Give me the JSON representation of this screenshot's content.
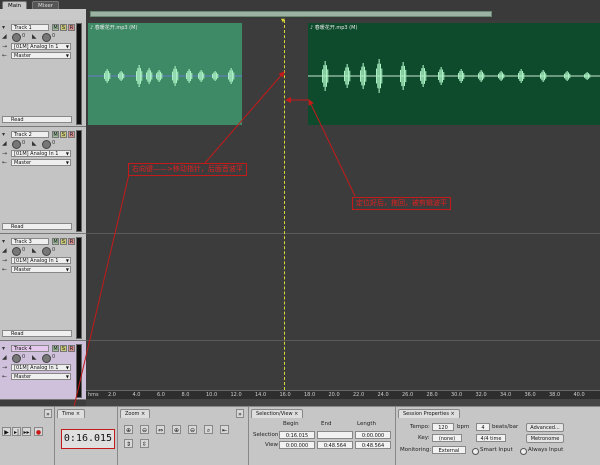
{
  "top_tabs": [
    "Main",
    "Mixer"
  ],
  "tracks": [
    {
      "name": "Track 1",
      "input": "[01M] Analog In 1",
      "output": "Master",
      "automation": "Read",
      "volume": "0",
      "pan": "0",
      "selected": false
    },
    {
      "name": "Track 2",
      "input": "[01M] Analog In 1",
      "output": "Master",
      "automation": "Read",
      "volume": "0",
      "pan": "0",
      "selected": false
    },
    {
      "name": "Track 3",
      "input": "[01M] Analog In 1",
      "output": "Master",
      "automation": "Read",
      "volume": "0",
      "pan": "0",
      "selected": false
    },
    {
      "name": "Track 4",
      "input": "[01M] Analog In 1",
      "output": "Master",
      "automation": "Read",
      "volume": "0",
      "pan": "0",
      "selected": true
    }
  ],
  "track_buttons": {
    "mute": "M",
    "solo": "S",
    "record": "R"
  },
  "clips": [
    {
      "label": "♪ 春暖花开.mp3 (M)"
    },
    {
      "label": "♪ 春暖花开.mp3 (M)"
    }
  ],
  "ruler": {
    "unit": "hms",
    "ticks": [
      "2.0",
      "4.0",
      "6.0",
      "8.0",
      "10.0",
      "12.0",
      "14.0",
      "16.0",
      "18.0",
      "20.0",
      "22.0",
      "24.0",
      "26.0",
      "28.0",
      "30.0",
      "32.0",
      "34.0",
      "36.0",
      "38.0",
      "40.0"
    ]
  },
  "annotations": {
    "left_note": "右向键——>移动指针，后面音波平",
    "right_note": "定位好后，拖回，被剪辑波平"
  },
  "time_panel": {
    "tab": "Time",
    "value": "0:16.015"
  },
  "zoom_panel": {
    "tab": "Zoom"
  },
  "selection_panel": {
    "tab": "Selection/View",
    "headers": [
      "Begin",
      "End",
      "Length"
    ],
    "selection_label": "Selection",
    "view_label": "View",
    "selection": [
      "0:16.015",
      "",
      "0:00.000"
    ],
    "view": [
      "0:00.000",
      "0:48.564",
      "0:48.564"
    ]
  },
  "session_panel": {
    "tab": "Session Properties",
    "tempo_label": "Tempo:",
    "tempo": "120",
    "bpm": "bpm",
    "beats": "4",
    "beats_label": "beats/bar",
    "advanced": "Advanced...",
    "key_label": "Key:",
    "key": "(none)",
    "signature": "4/4 time",
    "metronome": "Metronome",
    "monitoring_label": "Monitoring:",
    "monitoring": "External",
    "smart_input": "Smart Input",
    "always_input": "Always Input"
  },
  "colors": {
    "clip_left": "#3f8a66",
    "clip_right": "#0e4a2c",
    "wave": "#a9f0c2",
    "annotation": "#d42020",
    "cursor": "#d8d838"
  }
}
